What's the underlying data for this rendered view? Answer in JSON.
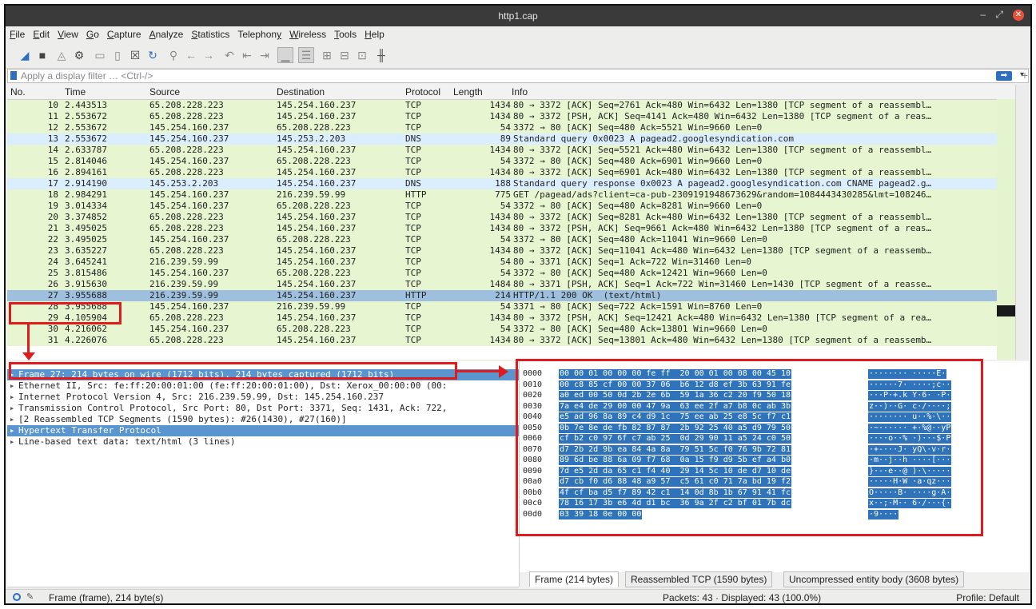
{
  "window": {
    "title": "http1.cap"
  },
  "window_controls": {
    "minimize": "–",
    "maximize": "⤢",
    "close": "✕"
  },
  "menu": [
    {
      "pre": "",
      "u": "F",
      "post": "ile"
    },
    {
      "pre": "",
      "u": "E",
      "post": "dit"
    },
    {
      "pre": "",
      "u": "V",
      "post": "iew"
    },
    {
      "pre": "",
      "u": "G",
      "post": "o"
    },
    {
      "pre": "",
      "u": "C",
      "post": "apture"
    },
    {
      "pre": "",
      "u": "A",
      "post": "nalyze"
    },
    {
      "pre": "",
      "u": "S",
      "post": "tatistics"
    },
    {
      "pre": "Telephon",
      "u": "y",
      "post": ""
    },
    {
      "pre": "",
      "u": "W",
      "post": "ireless"
    },
    {
      "pre": "",
      "u": "T",
      "post": "ools"
    },
    {
      "pre": "",
      "u": "H",
      "post": "elp"
    }
  ],
  "toolbar": {
    "icons": [
      "shark-fin-icon",
      "stop-icon",
      "restart-icon",
      "options-gear-icon",
      "open-file-icon",
      "save-file-icon",
      "close-file-icon",
      "reload-icon",
      "find-icon",
      "back-icon",
      "forward-icon",
      "go-to-packet-icon",
      "first-packet-icon",
      "last-packet-icon",
      "autoscroll-icon",
      "colorize-icon",
      "zoom-in-icon",
      "zoom-out-icon",
      "normal-size-icon",
      "resize-columns-icon"
    ]
  },
  "filter": {
    "placeholder": "Apply a display filter … <Ctrl-/>",
    "apply_glyph": "➡",
    "dropdown_glyph": "▾",
    "plus_glyph": "+"
  },
  "packet_list": {
    "columns": {
      "no": "No.",
      "time": "Time",
      "source": "Source",
      "destination": "Destination",
      "protocol": "Protocol",
      "length": "Length",
      "info": "Info"
    },
    "rows": [
      {
        "no": "10",
        "time": "2.443513",
        "src": "65.208.228.223",
        "dst": "145.254.160.237",
        "proto": "TCP",
        "len": "1434",
        "info": "80 → 3372 [ACK] Seq=2761 Ack=480 Win=6432 Len=1380 [TCP segment of a reassembl…",
        "kind": "tcp"
      },
      {
        "no": "11",
        "time": "2.553672",
        "src": "65.208.228.223",
        "dst": "145.254.160.237",
        "proto": "TCP",
        "len": "1434",
        "info": "80 → 3372 [PSH, ACK] Seq=4141 Ack=480 Win=6432 Len=1380 [TCP segment of a reas…",
        "kind": "tcp"
      },
      {
        "no": "12",
        "time": "2.553672",
        "src": "145.254.160.237",
        "dst": "65.208.228.223",
        "proto": "TCP",
        "len": "54",
        "info": "3372 → 80 [ACK] Seq=480 Ack=5521 Win=9660 Len=0",
        "kind": "tcp"
      },
      {
        "no": "13",
        "time": "2.553672",
        "src": "145.254.160.237",
        "dst": "145.253.2.203",
        "proto": "DNS",
        "len": "89",
        "info": "Standard query 0x0023 A pagead2.googlesyndication.com",
        "kind": "dns"
      },
      {
        "no": "14",
        "time": "2.633787",
        "src": "65.208.228.223",
        "dst": "145.254.160.237",
        "proto": "TCP",
        "len": "1434",
        "info": "80 → 3372 [ACK] Seq=5521 Ack=480 Win=6432 Len=1380 [TCP segment of a reassembl…",
        "kind": "tcp"
      },
      {
        "no": "15",
        "time": "2.814046",
        "src": "145.254.160.237",
        "dst": "65.208.228.223",
        "proto": "TCP",
        "len": "54",
        "info": "3372 → 80 [ACK] Seq=480 Ack=6901 Win=9660 Len=0",
        "kind": "tcp"
      },
      {
        "no": "16",
        "time": "2.894161",
        "src": "65.208.228.223",
        "dst": "145.254.160.237",
        "proto": "TCP",
        "len": "1434",
        "info": "80 → 3372 [ACK] Seq=6901 Ack=480 Win=6432 Len=1380 [TCP segment of a reassembl…",
        "kind": "tcp"
      },
      {
        "no": "17",
        "time": "2.914190",
        "src": "145.253.2.203",
        "dst": "145.254.160.237",
        "proto": "DNS",
        "len": "188",
        "info": "Standard query response 0x0023 A pagead2.googlesyndication.com CNAME pagead2.g…",
        "kind": "dns"
      },
      {
        "no": "18",
        "time": "2.984291",
        "src": "145.254.160.237",
        "dst": "216.239.59.99",
        "proto": "HTTP",
        "len": "775",
        "info": "GET /pagead/ads?client=ca-pub-2309191948673629&random=1084443430285&lmt=108246…",
        "kind": "http"
      },
      {
        "no": "19",
        "time": "3.014334",
        "src": "145.254.160.237",
        "dst": "65.208.228.223",
        "proto": "TCP",
        "len": "54",
        "info": "3372 → 80 [ACK] Seq=480 Ack=8281 Win=9660 Len=0",
        "kind": "tcp"
      },
      {
        "no": "20",
        "time": "3.374852",
        "src": "65.208.228.223",
        "dst": "145.254.160.237",
        "proto": "TCP",
        "len": "1434",
        "info": "80 → 3372 [ACK] Seq=8281 Ack=480 Win=6432 Len=1380 [TCP segment of a reassembl…",
        "kind": "tcp"
      },
      {
        "no": "21",
        "time": "3.495025",
        "src": "65.208.228.223",
        "dst": "145.254.160.237",
        "proto": "TCP",
        "len": "1434",
        "info": "80 → 3372 [PSH, ACK] Seq=9661 Ack=480 Win=6432 Len=1380 [TCP segment of a reas…",
        "kind": "tcp"
      },
      {
        "no": "22",
        "time": "3.495025",
        "src": "145.254.160.237",
        "dst": "65.208.228.223",
        "proto": "TCP",
        "len": "54",
        "info": "3372 → 80 [ACK] Seq=480 Ack=11041 Win=9660 Len=0",
        "kind": "tcp"
      },
      {
        "no": "23",
        "time": "3.635227",
        "src": "65.208.228.223",
        "dst": "145.254.160.237",
        "proto": "TCP",
        "len": "1434",
        "info": "80 → 3372 [ACK] Seq=11041 Ack=480 Win=6432 Len=1380 [TCP segment of a reassemb…",
        "kind": "tcp"
      },
      {
        "no": "24",
        "time": "3.645241",
        "src": "216.239.59.99",
        "dst": "145.254.160.237",
        "proto": "TCP",
        "len": "54",
        "info": "80 → 3371 [ACK] Seq=1 Ack=722 Win=31460 Len=0",
        "kind": "tcp"
      },
      {
        "no": "25",
        "time": "3.815486",
        "src": "145.254.160.237",
        "dst": "65.208.228.223",
        "proto": "TCP",
        "len": "54",
        "info": "3372 → 80 [ACK] Seq=480 Ack=12421 Win=9660 Len=0",
        "kind": "tcp"
      },
      {
        "no": "26",
        "time": "3.915630",
        "src": "216.239.59.99",
        "dst": "145.254.160.237",
        "proto": "TCP",
        "len": "1484",
        "info": "80 → 3371 [PSH, ACK] Seq=1 Ack=722 Win=31460 Len=1430 [TCP segment of a reasse…",
        "kind": "tcp"
      },
      {
        "no": "27",
        "time": "3.955688",
        "src": "216.239.59.99",
        "dst": "145.254.160.237",
        "proto": "HTTP",
        "len": "214",
        "info": "HTTP/1.1 200 OK  (text/html)",
        "kind": "sel"
      },
      {
        "no": "28",
        "time": "3.955688",
        "src": "145.254.160.237",
        "dst": "216.239.59.99",
        "proto": "TCP",
        "len": "54",
        "info": "3371 → 80 [ACK] Seq=722 Ack=1591 Win=8760 Len=0",
        "kind": "tcp"
      },
      {
        "no": "29",
        "time": "4.105904",
        "src": "65.208.228.223",
        "dst": "145.254.160.237",
        "proto": "TCP",
        "len": "1434",
        "info": "80 → 3372 [PSH, ACK] Seq=12421 Ack=480 Win=6432 Len=1380 [TCP segment of a rea…",
        "kind": "tcp"
      },
      {
        "no": "30",
        "time": "4.216062",
        "src": "145.254.160.237",
        "dst": "65.208.228.223",
        "proto": "TCP",
        "len": "54",
        "info": "3372 → 80 [ACK] Seq=480 Ack=13801 Win=9660 Len=0",
        "kind": "tcp"
      },
      {
        "no": "31",
        "time": "4.226076",
        "src": "65.208.228.223",
        "dst": "145.254.160.237",
        "proto": "TCP",
        "len": "1434",
        "info": "80 → 3372 [ACK] Seq=13801 Ack=480 Win=6432 Len=1380 [TCP segment of a reassemb…",
        "kind": "tcp"
      }
    ]
  },
  "details": [
    {
      "text": "Frame 27: 214 bytes on wire (1712 bits), 214 bytes captured (1712 bits)",
      "selected": true
    },
    {
      "text": "Ethernet II, Src: fe:ff:20:00:01:00 (fe:ff:20:00:01:00), Dst: Xerox_00:00:00 (00:",
      "selected": false
    },
    {
      "text": "Internet Protocol Version 4, Src: 216.239.59.99, Dst: 145.254.160.237",
      "selected": false
    },
    {
      "text": "Transmission Control Protocol, Src Port: 80, Dst Port: 3371, Seq: 1431, Ack: 722,",
      "selected": false
    },
    {
      "text": "[2 Reassembled TCP Segments (1590 bytes): #26(1430), #27(160)]",
      "selected": false
    },
    {
      "text": "Hypertext Transfer Protocol",
      "selected": true
    },
    {
      "text": "Line-based text data: text/html (3 lines)",
      "selected": false
    }
  ],
  "bytes": [
    {
      "off": "0000",
      "hex": "00 00 01 00 00 00 fe ff  20 00 01 00 08 00 45 10",
      "ascii": "········ ·····E·"
    },
    {
      "off": "0010",
      "hex": "00 c8 85 cf 00 00 37 06  b6 12 d8 ef 3b 63 91 fe",
      "ascii": "······7· ····;c··"
    },
    {
      "off": "0020",
      "hex": "a0 ed 00 50 0d 2b 2e 6b  59 1a 36 c2 20 f9 50 18",
      "ascii": "···P·+.k Y·6· ·P·"
    },
    {
      "off": "0030",
      "hex": "7a e4 de 29 00 00 47 9a  63 ee 2f a7 b8 0c ab 3b",
      "ascii": "z··)··G· c·/····;"
    },
    {
      "off": "0040",
      "hex": "e5 ad 96 8a 89 c4 d9 1c  75 ee ab 25 e8 5c f7 c1",
      "ascii": "········ u··%·\\··"
    },
    {
      "off": "0050",
      "hex": "0b 7e 8e de fb 82 87 87  2b 92 25 40 a5 d9 79 50",
      "ascii": "·~······ +·%@··yP"
    },
    {
      "off": "0060",
      "hex": "cf b2 c0 97 6f c7 ab 25  0d 29 90 11 a5 24 c0 50",
      "ascii": "····o··% ·)···$·P"
    },
    {
      "off": "0070",
      "hex": "d7 2b 2d 9b ea 84 4a 8a  79 51 5c f0 76 9b 72 81",
      "ascii": "·+-···J· yQ\\·v·r·"
    },
    {
      "off": "0080",
      "hex": "89 6d be 88 6a 09 f7 68  0a 15 f9 d9 5b ef a4 b0",
      "ascii": "·m··j··h ····[···"
    },
    {
      "off": "0090",
      "hex": "7d e5 2d da 65 c1 f4 40  29 14 5c 10 de d7 10 de",
      "ascii": "}·-·e··@ )·\\·····"
    },
    {
      "off": "00a0",
      "hex": "d7 cb f0 d6 88 48 a9 57  c5 61 c0 71 7a bd 19 f2",
      "ascii": "·····H·W ·a·qz···"
    },
    {
      "off": "00b0",
      "hex": "4f cf ba d5 f7 89 42 c1  14 0d 8b 1b 67 91 41 fc",
      "ascii": "O·····B· ····g·A·"
    },
    {
      "off": "00c0",
      "hex": "78 16 17 3b e6 4d d1 bc  36 9a 2f c2 bf 01 7b dc",
      "ascii": "x··;·M·· 6·/···{·"
    },
    {
      "off": "00d0",
      "hex": "03 39 18 0e 00 00",
      "ascii": "·9····"
    }
  ],
  "bytes_tabs": [
    "Frame (214 bytes)",
    "Reassembled TCP (1590 bytes)",
    "Uncompressed entity body (3608 bytes)"
  ],
  "status": {
    "text": "Frame (frame), 214 byte(s)",
    "packets": "Packets: 43 · Displayed: 43 (100.0%)",
    "profile": "Profile: Default"
  },
  "colors": {
    "tcp_row": "#e7f6d0",
    "dns_row": "#dbeeff",
    "selected_row": "#9ec0de",
    "selected_tree": "#5a95cf",
    "bytes_highlight": "#2f74ba",
    "annotation": "#e11b1b"
  }
}
